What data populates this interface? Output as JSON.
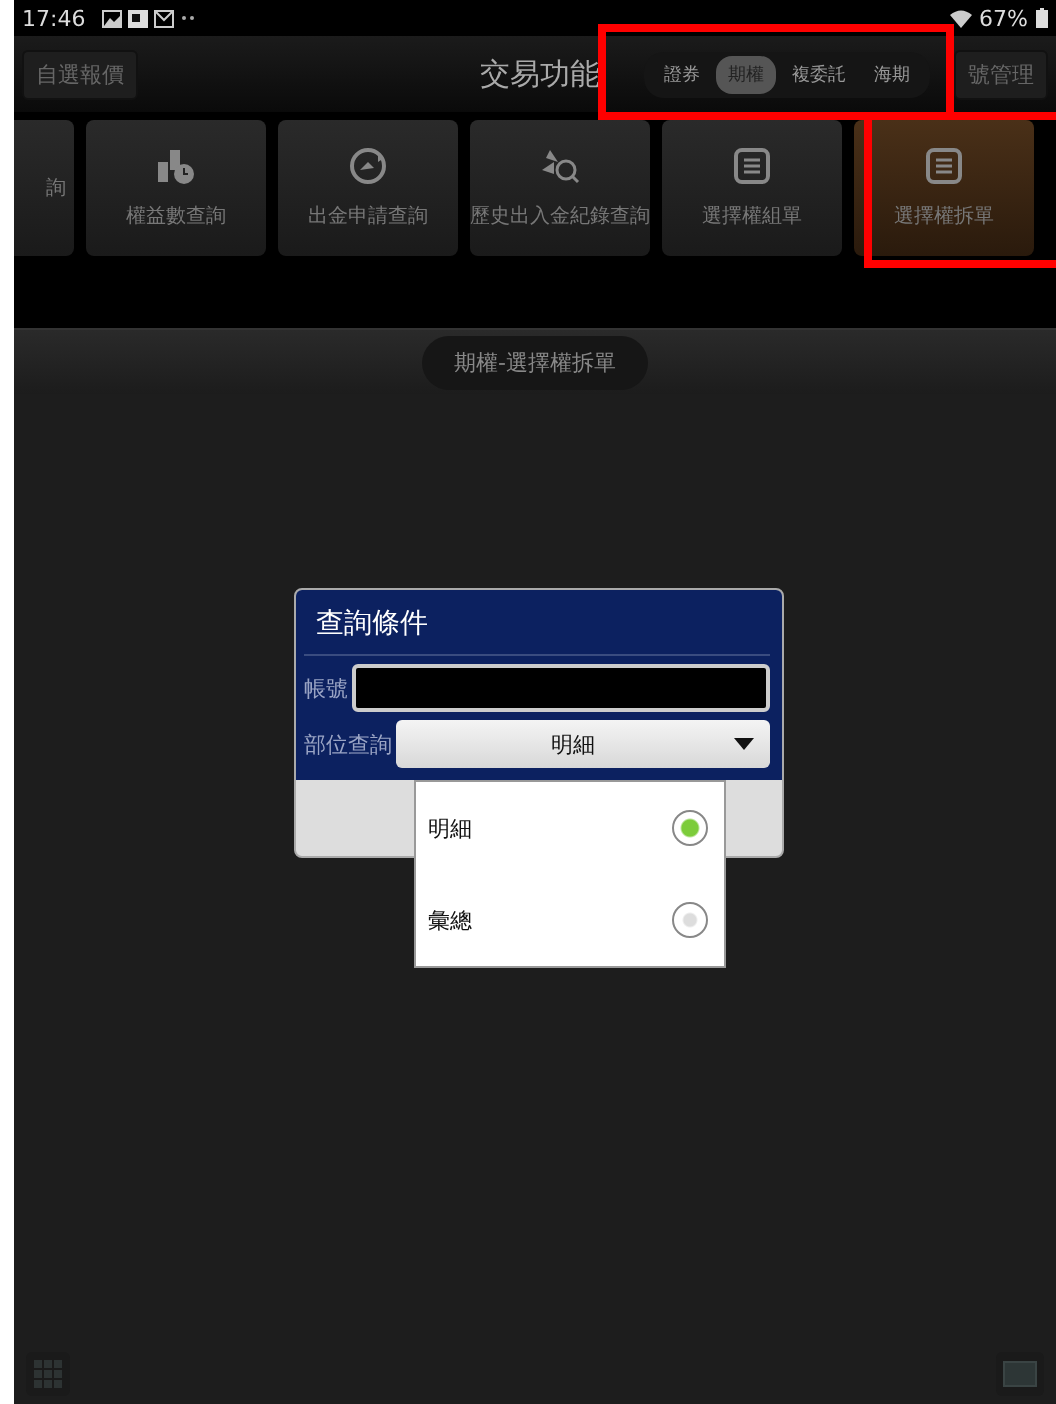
{
  "status_bar": {
    "time": "17:46",
    "battery": "67%"
  },
  "header": {
    "left_button": "自選報價",
    "title": "交易功能",
    "segments": [
      {
        "label": "證券",
        "selected": false
      },
      {
        "label": "期權",
        "selected": true
      },
      {
        "label": "複委託",
        "selected": false
      },
      {
        "label": "海期",
        "selected": false
      }
    ],
    "right_button": "號管理"
  },
  "tiles": [
    {
      "label": "詢",
      "kind": "plain",
      "selected": false
    },
    {
      "label": "權益數查詢",
      "kind": "coins",
      "selected": false
    },
    {
      "label": "出金申請查詢",
      "kind": "circle",
      "selected": false
    },
    {
      "label": "歷史出入金紀錄查詢",
      "kind": "arrows",
      "selected": false
    },
    {
      "label": "選擇權組單",
      "kind": "list",
      "selected": false
    },
    {
      "label": "選擇權拆單",
      "kind": "list",
      "selected": true
    }
  ],
  "page_title": "期權-選擇權拆單",
  "dialog": {
    "title": "查詢條件",
    "account_label": "帳號",
    "position_label": "部位查詢",
    "position_value": "明細"
  },
  "dropdown_options": [
    {
      "label": "明細",
      "selected": true
    },
    {
      "label": "彙總",
      "selected": false
    }
  ]
}
